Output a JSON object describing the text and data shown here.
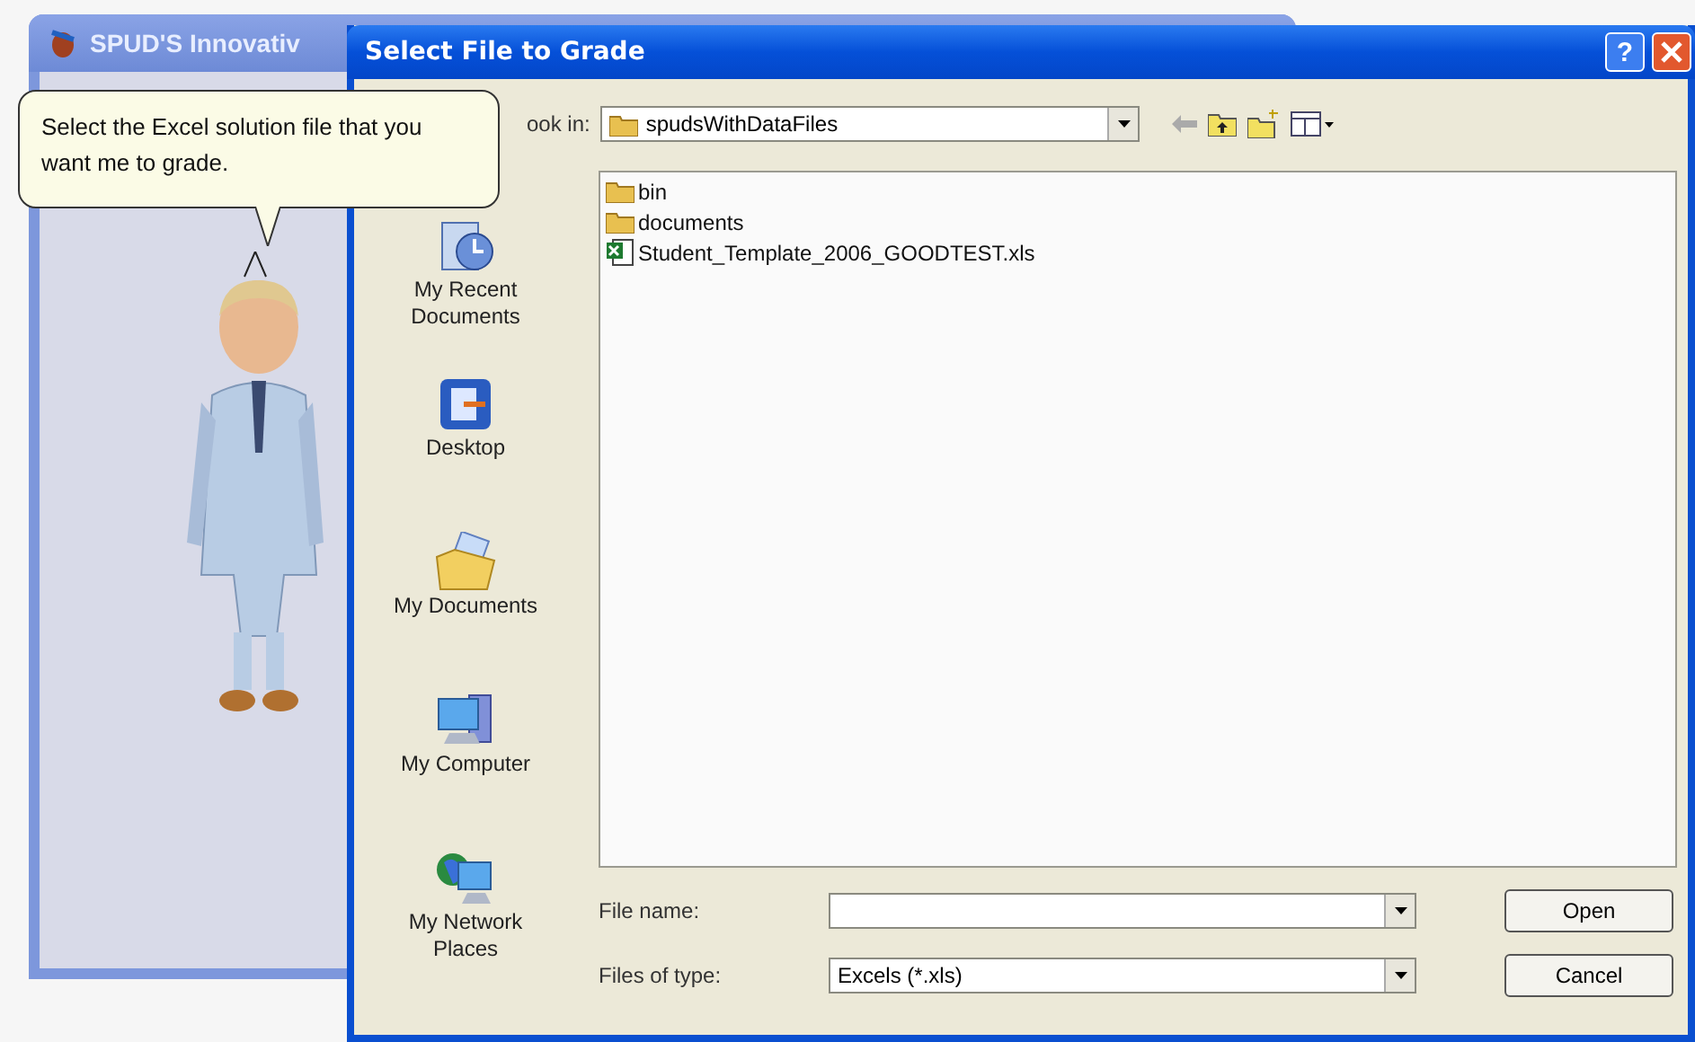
{
  "background_window": {
    "title": "SPUD'S Innovativ"
  },
  "balloon": {
    "text": "Select the Excel solution file that you want me to grade."
  },
  "dialog": {
    "title": "Select File to Grade",
    "help": "?",
    "look_in": {
      "label": "ook in:",
      "value": "spudsWithDataFiles"
    },
    "places": [
      {
        "label": "My Recent Documents",
        "kind": "recent"
      },
      {
        "label": "Desktop",
        "kind": "desktop"
      },
      {
        "label": "My Documents",
        "kind": "documents"
      },
      {
        "label": "My Computer",
        "kind": "computer"
      },
      {
        "label": "My Network Places",
        "kind": "network"
      }
    ],
    "files": [
      {
        "name": "bin",
        "kind": "folder"
      },
      {
        "name": "documents",
        "kind": "folder"
      },
      {
        "name": "Student_Template_2006_GOODTEST.xls",
        "kind": "excel"
      }
    ],
    "file_name": {
      "label": "File name:"
    },
    "file_type": {
      "label": "Files of type:",
      "value": "Excels (*.xls)"
    },
    "buttons": [
      "Open",
      "Cancel"
    ]
  }
}
